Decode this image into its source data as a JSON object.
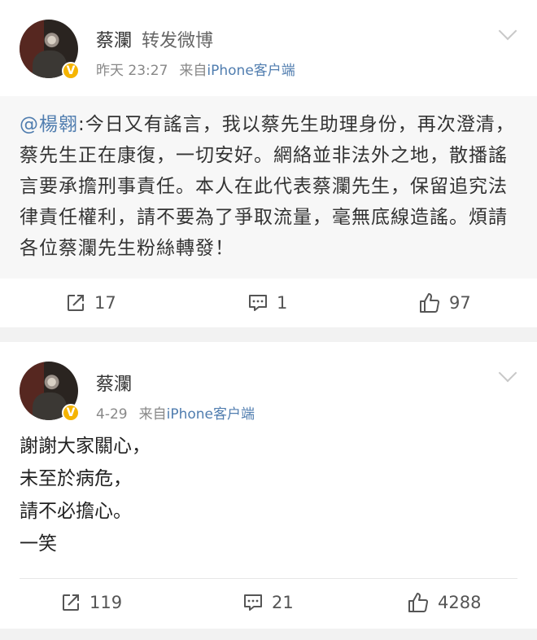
{
  "posts": [
    {
      "author": "蔡瀾",
      "action": "转发微博",
      "time": "昨天 23:27",
      "source_prefix": "来自",
      "source_app": "iPhone客户端",
      "repost": {
        "mention": "@楊翱",
        "text": ":今日又有謠言，我以蔡先生助理身份，再次澄清，蔡先生正在康復，一切安好。網絡並非法外之地，散播謠言要承擔刑事責任。本人在此代表蔡瀾先生，保留追究法律責任權利，請不要為了爭取流量，毫無底線造謠。煩請各位蔡瀾先生粉絲轉發！"
      },
      "reposts": "17",
      "comments": "1",
      "likes": "97"
    },
    {
      "author": "蔡瀾",
      "time": "4-29",
      "source_prefix": "来自",
      "source_app": "iPhone客户端",
      "text": "謝謝大家關心，\n未至於病危，\n請不必擔心。\n一笑",
      "reposts": "119",
      "comments": "21",
      "likes": "4288"
    }
  ],
  "badge": "V",
  "colors": {
    "link": "#507daf",
    "badge": "#f5b400",
    "background": "#f2f2f2"
  }
}
